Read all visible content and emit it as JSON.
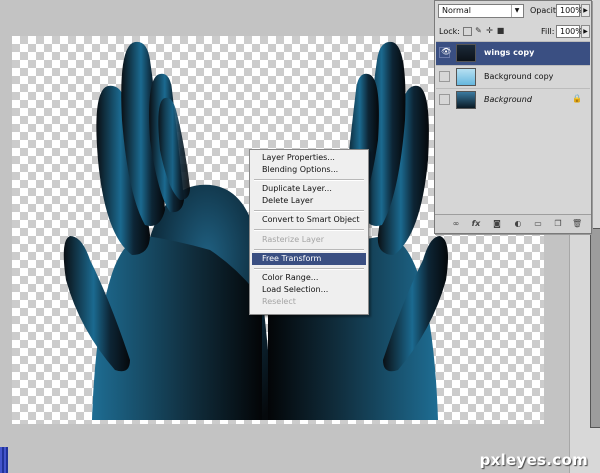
{
  "layers_panel": {
    "blend_mode": "Normal",
    "opacity_label": "Opacity:",
    "opacity_value": "100%",
    "lock_label": "Lock:",
    "fill_label": "Fill:",
    "fill_value": "100%",
    "layers": [
      {
        "name": "wings copy",
        "selected": true,
        "visible": true,
        "thumbnail": "dark-hands"
      },
      {
        "name": "Background copy",
        "selected": false,
        "visible": false,
        "thumbnail": "light-hands"
      },
      {
        "name": "Background",
        "selected": false,
        "visible": false,
        "thumbnail": "blue-hands",
        "locked": true
      }
    ],
    "footer_icons": [
      "link-icon",
      "fx-icon",
      "mask-icon",
      "adjustment-icon",
      "folder-icon",
      "new-layer-icon",
      "trash-icon"
    ]
  },
  "context_menu": {
    "items": [
      {
        "label": "Layer Properties...",
        "enabled": true
      },
      {
        "label": "Blending Options...",
        "enabled": true
      },
      {
        "label": "Duplicate Layer...",
        "enabled": true
      },
      {
        "label": "Delete Layer",
        "enabled": true
      },
      {
        "label": "Convert to Smart Object",
        "enabled": true
      },
      {
        "label": "Rasterize Layer",
        "enabled": false
      },
      {
        "label": "Free Transform",
        "enabled": true,
        "highlighted": true
      },
      {
        "label": "Color Range...",
        "enabled": true
      },
      {
        "label": "Load Selection...",
        "enabled": true
      },
      {
        "label": "Reselect",
        "enabled": false
      }
    ]
  },
  "watermark": "pxleyes.com",
  "colors": {
    "highlight": "#3a4f82",
    "hand_base": "#1c6e96",
    "hand_dark": "#0a0f14",
    "workspace": "#c3c3c3"
  }
}
